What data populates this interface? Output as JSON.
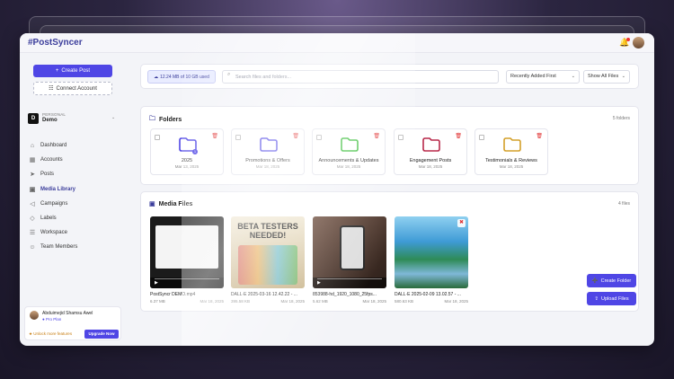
{
  "app": {
    "brand": "#PostSyncer"
  },
  "sidebar": {
    "create_post": "Create Post",
    "connect_account": "Connect Account",
    "workspace": {
      "type": "PERSONAL",
      "name": "Demo",
      "logo": "D"
    },
    "items": [
      {
        "label": "Dashboard",
        "icon": "home-icon"
      },
      {
        "label": "Accounts",
        "icon": "grid-icon"
      },
      {
        "label": "Posts",
        "icon": "send-icon"
      },
      {
        "label": "Media Library",
        "icon": "image-icon"
      },
      {
        "label": "Campaigns",
        "icon": "megaphone-icon"
      },
      {
        "label": "Labels",
        "icon": "tag-icon"
      },
      {
        "label": "Workspace",
        "icon": "layers-icon"
      },
      {
        "label": "Team Members",
        "icon": "users-icon"
      }
    ],
    "active_item": "Media Library",
    "user": {
      "name": "Abduimejid Shamsu Awel",
      "plan": "Pro Plan",
      "unlock": "Unlock more features",
      "upgrade": "Upgrade Now"
    }
  },
  "toolbar": {
    "storage": "12.24 MB of 10 GB used",
    "search_placeholder": "Search files and folders...",
    "sort": "Recently Added First",
    "filter": "Show All Files"
  },
  "folders": {
    "title": "Folders",
    "count": "5 folders",
    "items": [
      {
        "name": "2025",
        "date": "Mar 13, 2025",
        "color": "#4f46e5",
        "badge": "1"
      },
      {
        "name": "Promotions & Offers",
        "date": "Mar 18, 2025",
        "color": "#4f46e5"
      },
      {
        "name": "Announcements & Updates",
        "date": "Mar 18, 2025",
        "color": "#3fbf3f"
      },
      {
        "name": "Engagement Posts",
        "date": "Mar 18, 2025",
        "color": "#b8294a"
      },
      {
        "name": "Testimonials & Reviews",
        "date": "Mar 18, 2025",
        "color": "#d4a02a"
      }
    ]
  },
  "media": {
    "title": "Media Files",
    "count": "4 files",
    "items": [
      {
        "name": "PostSyncr DEMO.mp4",
        "size": "6.37 MB",
        "date": "Mar 18, 2025"
      },
      {
        "name": "DALL·E 2025-03-16 12.42.22 - ...",
        "size": "395.58 KB",
        "date": "Mar 18, 2025",
        "thumb_text": "BETA TESTERS NEEDED!"
      },
      {
        "name": "853988-hd_1920_1080_25fps...",
        "size": "5.62 MB",
        "date": "Mar 18, 2025"
      },
      {
        "name": "DALL·E 2025-02-09 13.02.57 - ...",
        "size": "580.63 KB",
        "date": "Mar 18, 2025"
      }
    ]
  },
  "actions": {
    "create_folder": "Create Folder",
    "upload_files": "Upload Files"
  }
}
